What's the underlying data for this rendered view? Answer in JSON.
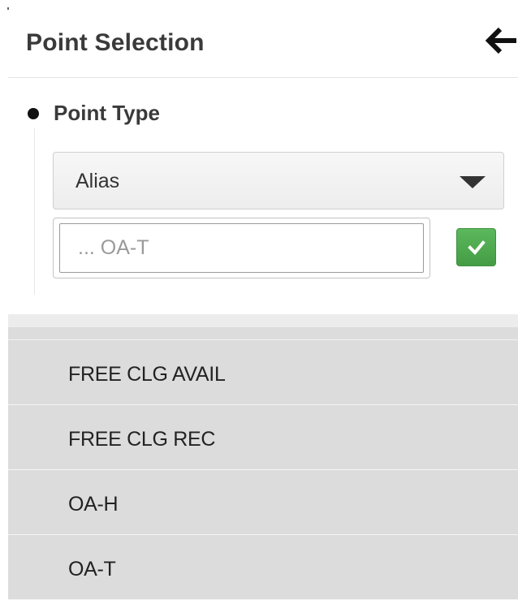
{
  "header": {
    "title": "Point Selection",
    "back_icon": "arrow-left-icon"
  },
  "point_type": {
    "label": "Point Type",
    "select": {
      "selected": "Alias",
      "caret_icon": "caret-down-icon"
    },
    "search": {
      "value": "",
      "placeholder": "... OA-T"
    },
    "confirm": {
      "icon": "check-icon",
      "color": "#5cb85c"
    }
  },
  "results": {
    "items": [
      {
        "label": "FREE CLG AVAIL"
      },
      {
        "label": "FREE CLG REC"
      },
      {
        "label": "OA-H"
      },
      {
        "label": "OA-T"
      }
    ]
  },
  "colors": {
    "list_background": "#dcdcdc",
    "accent_green": "#5cb85c"
  }
}
